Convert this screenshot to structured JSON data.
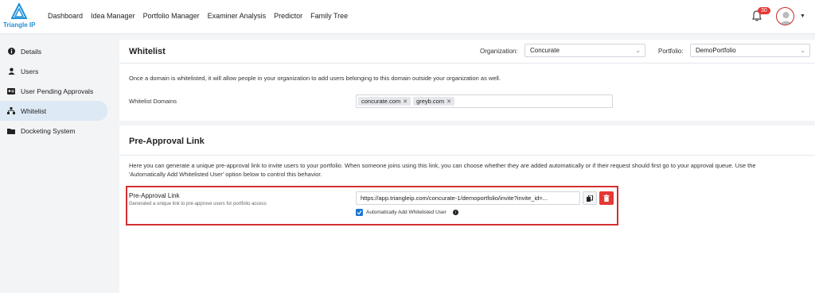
{
  "brand": {
    "name": "Triangle IP",
    "color": "#1d8fd8"
  },
  "nav": [
    "Dashboard",
    "Idea Manager",
    "Portfolio Manager",
    "Examiner Analysis",
    "Predictor",
    "Family Tree"
  ],
  "header": {
    "notification_count": "30"
  },
  "sidebar": {
    "items": [
      {
        "label": "Details",
        "icon": "info-icon"
      },
      {
        "label": "Users",
        "icon": "user-icon"
      },
      {
        "label": "User Pending Approvals",
        "icon": "id-card-icon"
      },
      {
        "label": "Whitelist",
        "icon": "sitemap-icon",
        "active": true
      },
      {
        "label": "Docketing System",
        "icon": "folder-icon"
      }
    ]
  },
  "whitelist": {
    "title": "Whitelist",
    "organization_label": "Organization:",
    "organization_value": "Concurate",
    "portfolio_label": "Portfolio:",
    "portfolio_value": "DemoPortfolio",
    "description": "Once a domain is whitelisted, it will allow people in your organization to add users belonging to this domain outside your organization as well.",
    "domains_label": "Whitelist Domains",
    "domains": [
      "concurate.com",
      "greyb.com"
    ]
  },
  "preapproval": {
    "title": "Pre-Approval Link",
    "description_line1": "Here you can generate a unique pre-approval link to invite users to your portfolio. When someone joins using this link, you can choose whether they are added automatically or if their request should first go to your approval queue. Use the",
    "description_line2": "'Automatically Add Whitelisted User' option below to control this behavior.",
    "link_label": "Pre-Approval Link",
    "link_sublabel": "Generated a unique link to pre-approve users for portfolio access",
    "link_value": "https://app.triangleip.com/concurate-1/demoportfolio/invite?invite_id=...",
    "checkbox_label": "Automatically Add Whitelisted User",
    "checkbox_checked": true
  }
}
